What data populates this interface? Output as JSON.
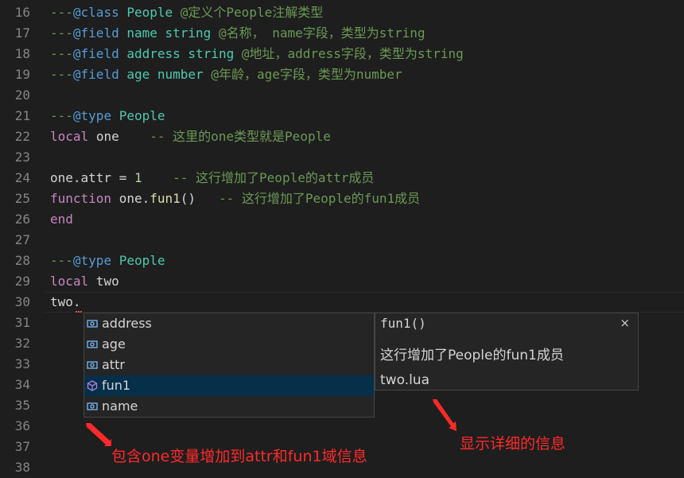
{
  "editor": {
    "lines": [
      {
        "n": "16",
        "tokens": [
          {
            "t": "---",
            "c": "cm"
          },
          {
            "t": "@class",
            "c": "tag"
          },
          {
            "t": " ",
            "c": "cm"
          },
          {
            "t": "People",
            "c": "ty"
          },
          {
            "t": " @定义个People注解类型",
            "c": "cm"
          }
        ]
      },
      {
        "n": "17",
        "tokens": [
          {
            "t": "---",
            "c": "cm"
          },
          {
            "t": "@field",
            "c": "tag"
          },
          {
            "t": " ",
            "c": "cm"
          },
          {
            "t": "name",
            "c": "ty"
          },
          {
            "t": " ",
            "c": "cm"
          },
          {
            "t": "string",
            "c": "ty"
          },
          {
            "t": " @名称， name字段，类型为string",
            "c": "cm"
          }
        ]
      },
      {
        "n": "18",
        "tokens": [
          {
            "t": "---",
            "c": "cm"
          },
          {
            "t": "@field",
            "c": "tag"
          },
          {
            "t": " ",
            "c": "cm"
          },
          {
            "t": "address",
            "c": "ty"
          },
          {
            "t": " ",
            "c": "cm"
          },
          {
            "t": "string",
            "c": "ty"
          },
          {
            "t": " @地址，address字段，类型为string",
            "c": "cm"
          }
        ]
      },
      {
        "n": "19",
        "tokens": [
          {
            "t": "---",
            "c": "cm"
          },
          {
            "t": "@field",
            "c": "tag"
          },
          {
            "t": " ",
            "c": "cm"
          },
          {
            "t": "age",
            "c": "ty"
          },
          {
            "t": " ",
            "c": "cm"
          },
          {
            "t": "number",
            "c": "ty"
          },
          {
            "t": " @年龄，age字段，类型为number",
            "c": "cm"
          }
        ]
      },
      {
        "n": "20",
        "tokens": []
      },
      {
        "n": "21",
        "tokens": [
          {
            "t": "---",
            "c": "cm"
          },
          {
            "t": "@type",
            "c": "tag"
          },
          {
            "t": " ",
            "c": "cm"
          },
          {
            "t": "People",
            "c": "ty"
          }
        ]
      },
      {
        "n": "22",
        "tokens": [
          {
            "t": "local",
            "c": "kw"
          },
          {
            "t": " ",
            "c": "id"
          },
          {
            "t": "one",
            "c": "id"
          },
          {
            "t": "    ",
            "c": "id"
          },
          {
            "t": "-- 这里的one类型就是People",
            "c": "cm"
          }
        ]
      },
      {
        "n": "23",
        "tokens": []
      },
      {
        "n": "24",
        "tokens": [
          {
            "t": "one.attr",
            "c": "id"
          },
          {
            "t": " = ",
            "c": "id"
          },
          {
            "t": "1",
            "c": "num"
          },
          {
            "t": "    ",
            "c": "id"
          },
          {
            "t": "-- 这行增加了People的attr成员",
            "c": "cm"
          }
        ]
      },
      {
        "n": "25",
        "tokens": [
          {
            "t": "function",
            "c": "kw"
          },
          {
            "t": " one.",
            "c": "id"
          },
          {
            "t": "fun1",
            "c": "fn"
          },
          {
            "t": "()",
            "c": "id"
          },
          {
            "t": "   ",
            "c": "id"
          },
          {
            "t": "-- 这行增加了People的fun1成员",
            "c": "cm"
          }
        ]
      },
      {
        "n": "26",
        "tokens": [
          {
            "t": "end",
            "c": "kw"
          }
        ]
      },
      {
        "n": "27",
        "tokens": []
      },
      {
        "n": "28",
        "tokens": [
          {
            "t": "---",
            "c": "cm"
          },
          {
            "t": "@type",
            "c": "tag"
          },
          {
            "t": " ",
            "c": "cm"
          },
          {
            "t": "People",
            "c": "ty"
          }
        ]
      },
      {
        "n": "29",
        "tokens": [
          {
            "t": "local",
            "c": "kw"
          },
          {
            "t": " two",
            "c": "id"
          }
        ]
      },
      {
        "n": "30",
        "tokens": [
          {
            "t": "two.",
            "c": "id"
          }
        ]
      },
      {
        "n": "31",
        "tokens": []
      },
      {
        "n": "32",
        "tokens": []
      },
      {
        "n": "33",
        "tokens": []
      },
      {
        "n": "34",
        "tokens": []
      },
      {
        "n": "35",
        "tokens": []
      },
      {
        "n": "36",
        "tokens": []
      },
      {
        "n": "37",
        "tokens": []
      },
      {
        "n": "38",
        "tokens": []
      }
    ]
  },
  "suggest": {
    "items": [
      {
        "label": "address",
        "icon": "field-icon"
      },
      {
        "label": "age",
        "icon": "field-icon"
      },
      {
        "label": "attr",
        "icon": "field-icon"
      },
      {
        "label": "fun1",
        "icon": "method-icon"
      },
      {
        "label": "name",
        "icon": "field-icon"
      }
    ],
    "selected_index": 3
  },
  "detail": {
    "signature": "fun1()",
    "close": "×",
    "doc": "这行增加了People的fun1成员",
    "file": "two.lua"
  },
  "annotations": {
    "left": "包含one变量增加到attr和fun1域信息",
    "right": "显示详细的信息",
    "color": "#ff2a2a"
  }
}
